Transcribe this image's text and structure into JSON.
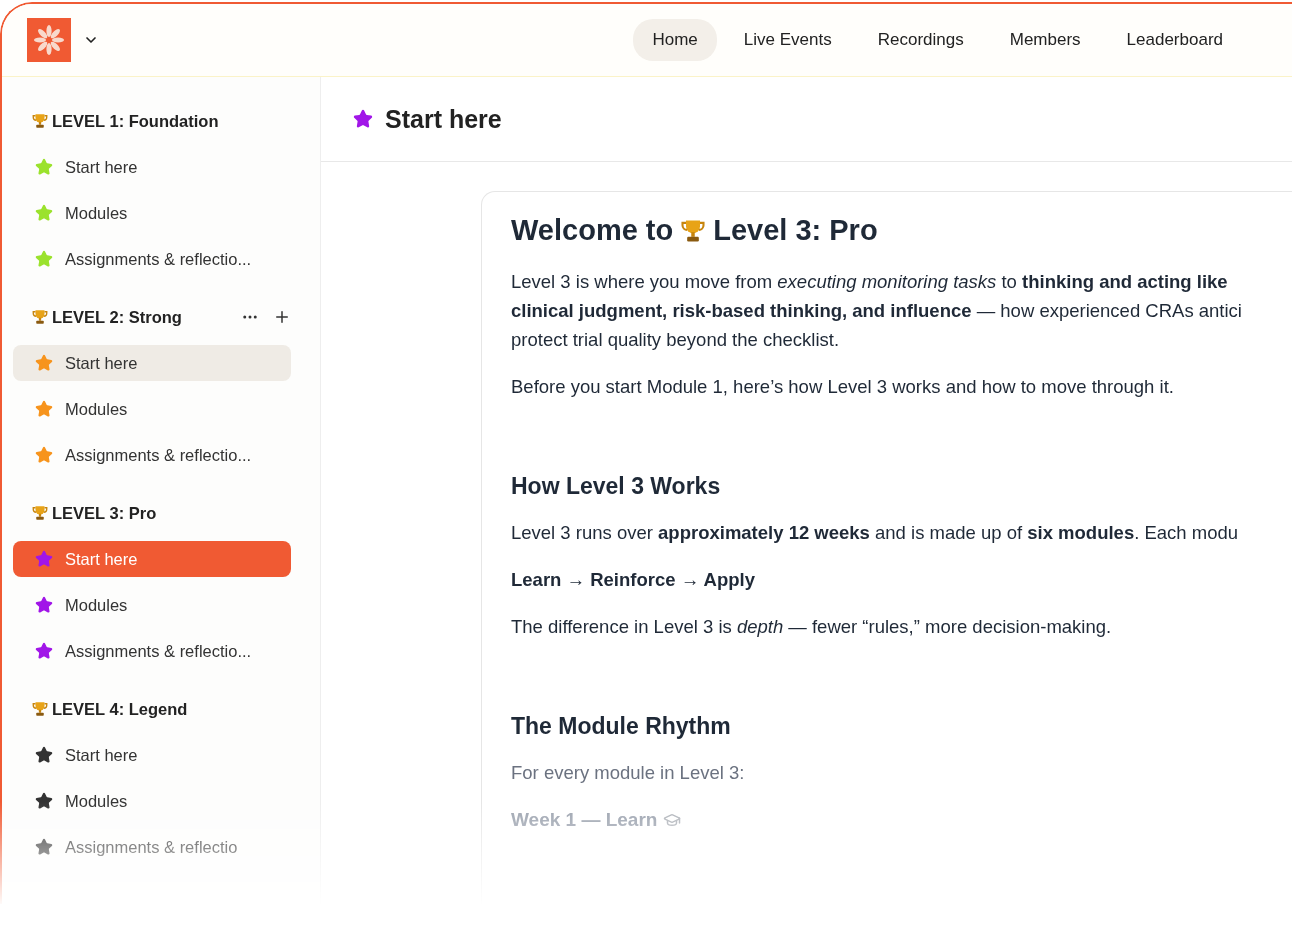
{
  "nav": {
    "tabs": [
      {
        "label": "Home",
        "selected": true
      },
      {
        "label": "Live Events",
        "selected": false
      },
      {
        "label": "Recordings",
        "selected": false
      },
      {
        "label": "Members",
        "selected": false
      },
      {
        "label": "Leaderboard",
        "selected": false
      }
    ]
  },
  "sidebar": {
    "groups": [
      {
        "title": "LEVEL 1: Foundation",
        "color": "#9be22d",
        "show_actions": false,
        "items": [
          {
            "label": "Start here",
            "selected": false,
            "hovered": false
          },
          {
            "label": "Modules",
            "selected": false,
            "hovered": false
          },
          {
            "label": "Assignments & reflectio...",
            "selected": false,
            "hovered": false
          }
        ]
      },
      {
        "title": "LEVEL 2: Strong",
        "color": "#f7941d",
        "show_actions": true,
        "items": [
          {
            "label": "Start here",
            "selected": false,
            "hovered": true
          },
          {
            "label": "Modules",
            "selected": false,
            "hovered": false
          },
          {
            "label": "Assignments & reflectio...",
            "selected": false,
            "hovered": false
          }
        ]
      },
      {
        "title": "LEVEL 3: Pro",
        "color": "#a116e8",
        "show_actions": false,
        "items": [
          {
            "label": "Start here",
            "selected": true,
            "hovered": false
          },
          {
            "label": "Modules",
            "selected": false,
            "hovered": false
          },
          {
            "label": "Assignments & reflectio...",
            "selected": false,
            "hovered": false
          }
        ]
      },
      {
        "title": "LEVEL 4: Legend",
        "color": "#333333",
        "show_actions": false,
        "items": [
          {
            "label": "Start here",
            "selected": false,
            "hovered": false
          },
          {
            "label": "Modules",
            "selected": false,
            "hovered": false
          },
          {
            "label": "Assignments & reflectio",
            "selected": false,
            "hovered": false
          }
        ]
      }
    ]
  },
  "page": {
    "title": "Start here",
    "content": [
      {
        "kind": "h1",
        "before": "Welcome to",
        "after": "Level 3: Pro"
      },
      {
        "kind": "p",
        "text": "Level 3 is where you move from *executing monitoring tasks* to **thinking and acting like**\n**clinical judgment, risk-based thinking, and influence** — how experienced CRAs antici\nprotect trial quality beyond the checklist."
      },
      {
        "kind": "p",
        "text": "Before you start Module 1, here’s how Level 3 works and how to move through it."
      },
      {
        "kind": "h2",
        "text": "How Level 3 Works"
      },
      {
        "kind": "p",
        "text": "Level 3 runs over **approximately 12 weeks** and is made up of **six modules**. Each modu"
      },
      {
        "kind": "strong",
        "text": "Learn → Reinforce → Apply"
      },
      {
        "kind": "p",
        "text": "The difference in Level 3 is *depth* — fewer “rules,” more decision-making."
      },
      {
        "kind": "h2",
        "text": "The Module Rhythm"
      },
      {
        "kind": "muted",
        "text": "For every module in Level 3:"
      },
      {
        "kind": "h3",
        "text": "Week 1 — Learn"
      }
    ]
  }
}
